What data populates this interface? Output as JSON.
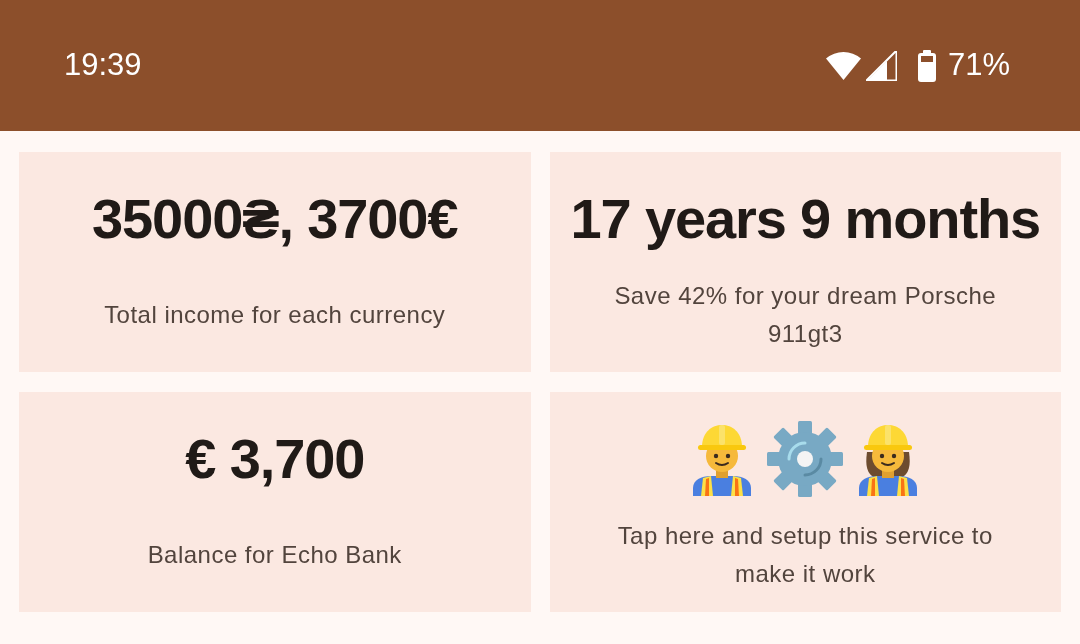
{
  "status_bar": {
    "time": "19:39",
    "battery_percent": "71%"
  },
  "cards": [
    {
      "kind": "stat",
      "value": "35000₴, 3700€",
      "caption": "Total income for each currency"
    },
    {
      "kind": "stat",
      "value": "17 years 9 months",
      "caption": "Save 42% for your dream Porsche 911gt3"
    },
    {
      "kind": "stat",
      "value": "€ 3,700",
      "caption": "Balance for Echo Bank"
    },
    {
      "kind": "setup",
      "caption": "Tap here and setup this service to make it work"
    }
  ]
}
